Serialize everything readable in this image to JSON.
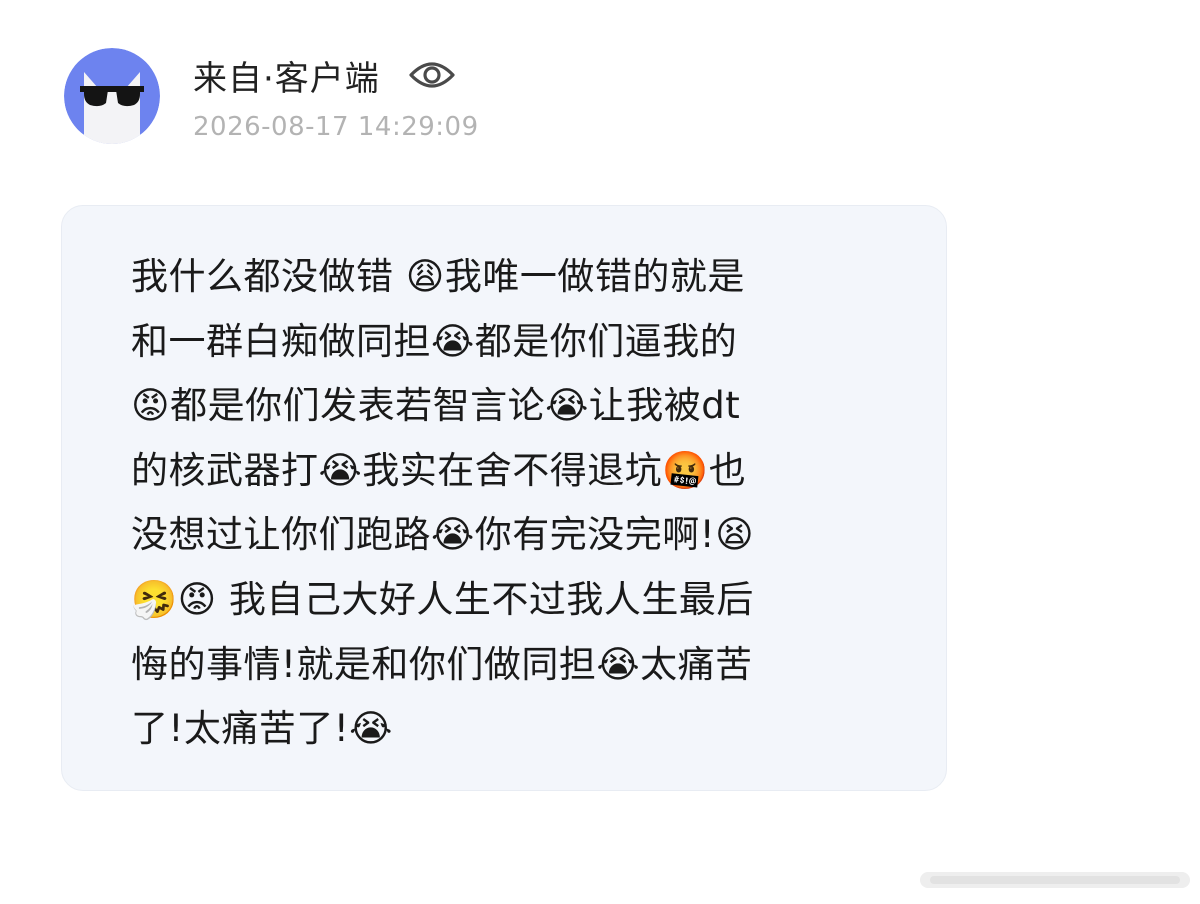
{
  "post": {
    "author_name": "来自·客户端",
    "timestamp": "2026-08-17 14:29:09",
    "view_icon": "eye-icon",
    "avatar_icon": "cat-with-sunglasses-avatar"
  },
  "message": {
    "lines": [
      "我什么都没做错 😩我唯一做错的就是",
      "和一群白痴做同担😭都是你们逼我的",
      "😡都是你们发表若智言论😭让我被dt",
      "的核武器打😭我实在舍不得退坑🤬也",
      "没想过让你们跑路😭你有完没完啊!😫",
      "🤧😡 我自己大好人生不过我人生最后",
      "悔的事情!就是和你们做同担😭太痛苦",
      "了!太痛苦了!😭"
    ]
  },
  "colors": {
    "avatar_bg": "#6d83ef",
    "bubble_bg": "#f3f6fb",
    "timestamp": "#b3b3b3"
  }
}
